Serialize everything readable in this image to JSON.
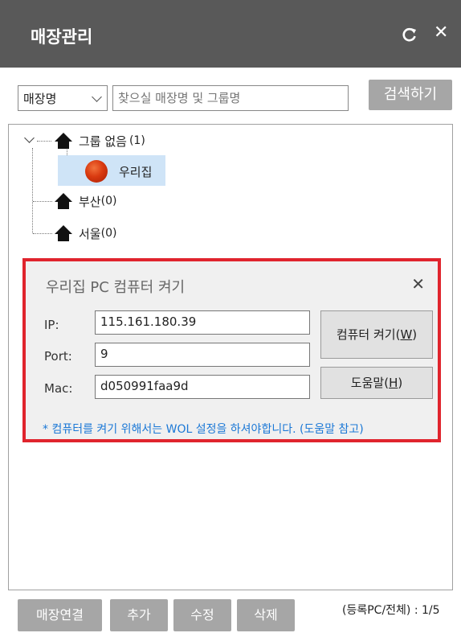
{
  "window": {
    "title": "매장관리",
    "refresh_icon": "refresh-icon",
    "close_icon": "close-icon",
    "close_glyph": "✕"
  },
  "search": {
    "category_selected": "매장명",
    "placeholder": "찾으실 매장명 및 그룹명",
    "button_label": "검색하기"
  },
  "tree": {
    "root": {
      "label": "그룹 없음",
      "count": "(1)",
      "icon": "home-icon"
    },
    "children": [
      {
        "label": "우리집",
        "icon": "status-ball-icon",
        "selected": true
      }
    ],
    "groups": [
      {
        "label": "부산",
        "count": "(0)",
        "icon": "home-icon"
      },
      {
        "label": "서울",
        "count": "(0)",
        "icon": "home-icon"
      }
    ]
  },
  "wol_dialog": {
    "title": "우리집 PC 컴퓨터 켜기",
    "close_glyph": "✕",
    "ip_label": "IP:",
    "ip_value": "115.161.180.39",
    "port_label": "Port:",
    "port_value": "9",
    "mac_label": "Mac:",
    "mac_value": "d050991faa9d",
    "power_on_label": "컴퓨터 켜기(",
    "power_on_key": "W",
    "power_on_close": ")",
    "help_label": "도움말(",
    "help_key": "H",
    "help_close": ")",
    "note": "* 컴퓨터를 켜기 위해서는 WOL 설정을 하셔야합니다. (도움말 참고)",
    "accent_color": "#e0242d",
    "note_color": "#1b78d6"
  },
  "footer": {
    "connect_label": "매장연결",
    "add_label": "추가",
    "edit_label": "수정",
    "delete_label": "삭제",
    "status_text": "(등록PC/전체) : 1/5"
  }
}
